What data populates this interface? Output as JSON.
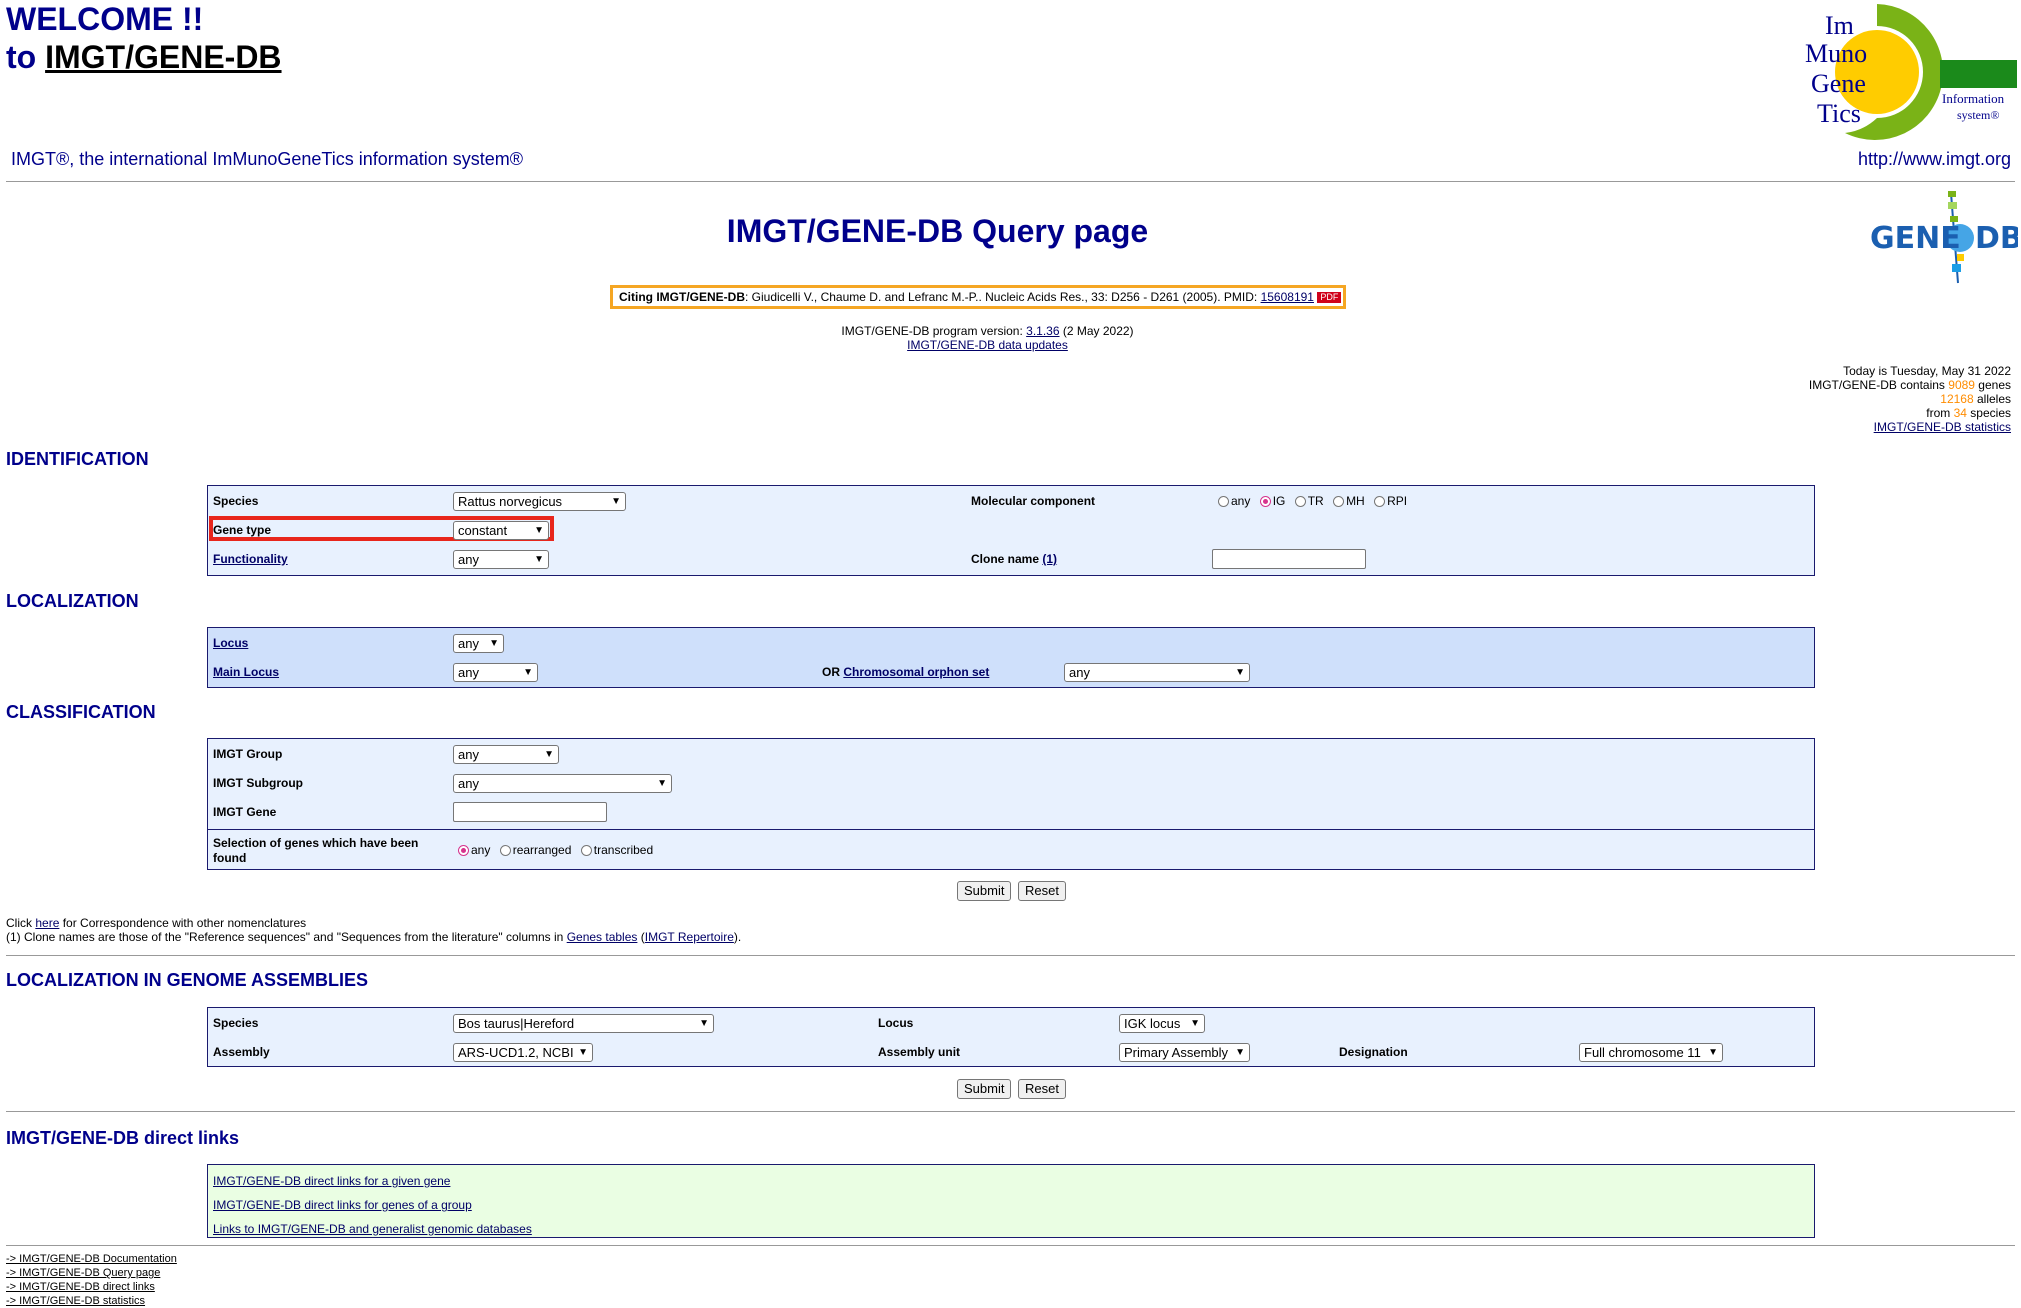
{
  "header": {
    "welcome_line1": "WELCOME !!",
    "welcome_to": "to ",
    "welcome_link": "IMGT/GENE-DB",
    "tagline": "IMGT®, the international ImMunoGeneTics information system®",
    "url": "http://www.imgt.org",
    "logo": {
      "im": "Im",
      "muno": "Muno",
      "gene": "Gene",
      "tics": "Tics",
      "info1": "Information",
      "info2": "system®"
    },
    "genedb_logo": "GENE DB"
  },
  "query": {
    "title": "IMGT/GENE-DB Query page",
    "cite_bold": "Citing IMGT/GENE-DB",
    "cite_text": ": Giudicelli V., Chaume D. and Lefranc M.-P.. Nucleic Acids Res., 33: D256 - D261 (2005). PMID: ",
    "cite_pmid": "15608191",
    "cite_pdf": "PDF",
    "version_prefix": "IMGT/GENE-DB program version: ",
    "version_link": "3.1.36",
    "version_date": " (2 May 2022)",
    "updates_link": "IMGT/GENE-DB data updates"
  },
  "stats": {
    "today": "Today is Tuesday, May 31 2022",
    "contains_prefix": "IMGT/GENE-DB contains ",
    "genes_count": "9089",
    "genes_label": " genes",
    "alleles_count": "12168",
    "alleles_label": " alleles",
    "from_label": "from ",
    "species_count": "34",
    "species_label": " species",
    "stats_link": "IMGT/GENE-DB statistics"
  },
  "identification": {
    "heading": "IDENTIFICATION",
    "species_label": "Species",
    "species_value": "Rattus norvegicus",
    "molecular_label": "Molecular component",
    "molecular_options": [
      "any",
      "IG",
      "TR",
      "MH",
      "RPI"
    ],
    "molecular_selected": "IG",
    "gene_type_label": "Gene type",
    "gene_type_value": "constant",
    "functionality_label": "Functionality",
    "functionality_value": "any",
    "clone_label": "Clone name ",
    "clone_ref": "(1)",
    "clone_value": ""
  },
  "localization": {
    "heading": "LOCALIZATION",
    "locus_label": "Locus",
    "locus_value": "any",
    "main_locus_label": "Main Locus",
    "main_locus_value": "any",
    "or_label": "OR ",
    "orphon_label": "Chromosomal orphon set",
    "orphon_value": "any"
  },
  "classification": {
    "heading": "CLASSIFICATION",
    "group_label": "IMGT Group",
    "group_value": "any",
    "subgroup_label": "IMGT Subgroup",
    "subgroup_value": "any",
    "gene_label": "IMGT Gene",
    "gene_value": "",
    "selection_label_1": "Selection of genes which have been",
    "selection_label_2": "found",
    "selection_options": [
      "any",
      "rearranged",
      "transcribed"
    ],
    "selection_selected": "any",
    "submit": "Submit",
    "reset": "Reset"
  },
  "notes": {
    "click": "Click ",
    "here": "here",
    "click_rest": " for Correspondence with other nomenclatures",
    "note1_prefix": "(1) Clone names are those of the \"Reference sequences\" and \"Sequences from the literature\" columns in ",
    "genes_tables": "Genes tables",
    "note1_mid": " (",
    "imgt_repertoire": "IMGT Repertoire",
    "note1_end": ")."
  },
  "assemblies": {
    "heading": "LOCALIZATION IN GENOME ASSEMBLIES",
    "species_label": "Species",
    "species_value": "Bos taurus|Hereford",
    "locus_label": "Locus",
    "locus_value": "IGK locus",
    "assembly_label": "Assembly",
    "assembly_value": "ARS-UCD1.2, NCBI",
    "unit_label": "Assembly unit",
    "unit_value": "Primary Assembly",
    "designation_label": "Designation",
    "designation_value": "Full chromosome 11",
    "submit": "Submit",
    "reset": "Reset"
  },
  "direct_links": {
    "heading": "IMGT/GENE-DB direct links",
    "items": [
      "IMGT/GENE-DB direct links for a given gene",
      "IMGT/GENE-DB direct links for genes of a group",
      "Links to IMGT/GENE-DB and generalist genomic databases"
    ]
  },
  "footer": {
    "items": [
      "-> IMGT/GENE-DB Documentation",
      "-> IMGT/GENE-DB Query page",
      "-> IMGT/GENE-DB direct links",
      "-> IMGT/GENE-DB statistics"
    ]
  },
  "colors": {
    "navy": "#00008b",
    "highlight": "#e8261c",
    "cite_border": "#f5a623",
    "count": "#ff8c00"
  }
}
